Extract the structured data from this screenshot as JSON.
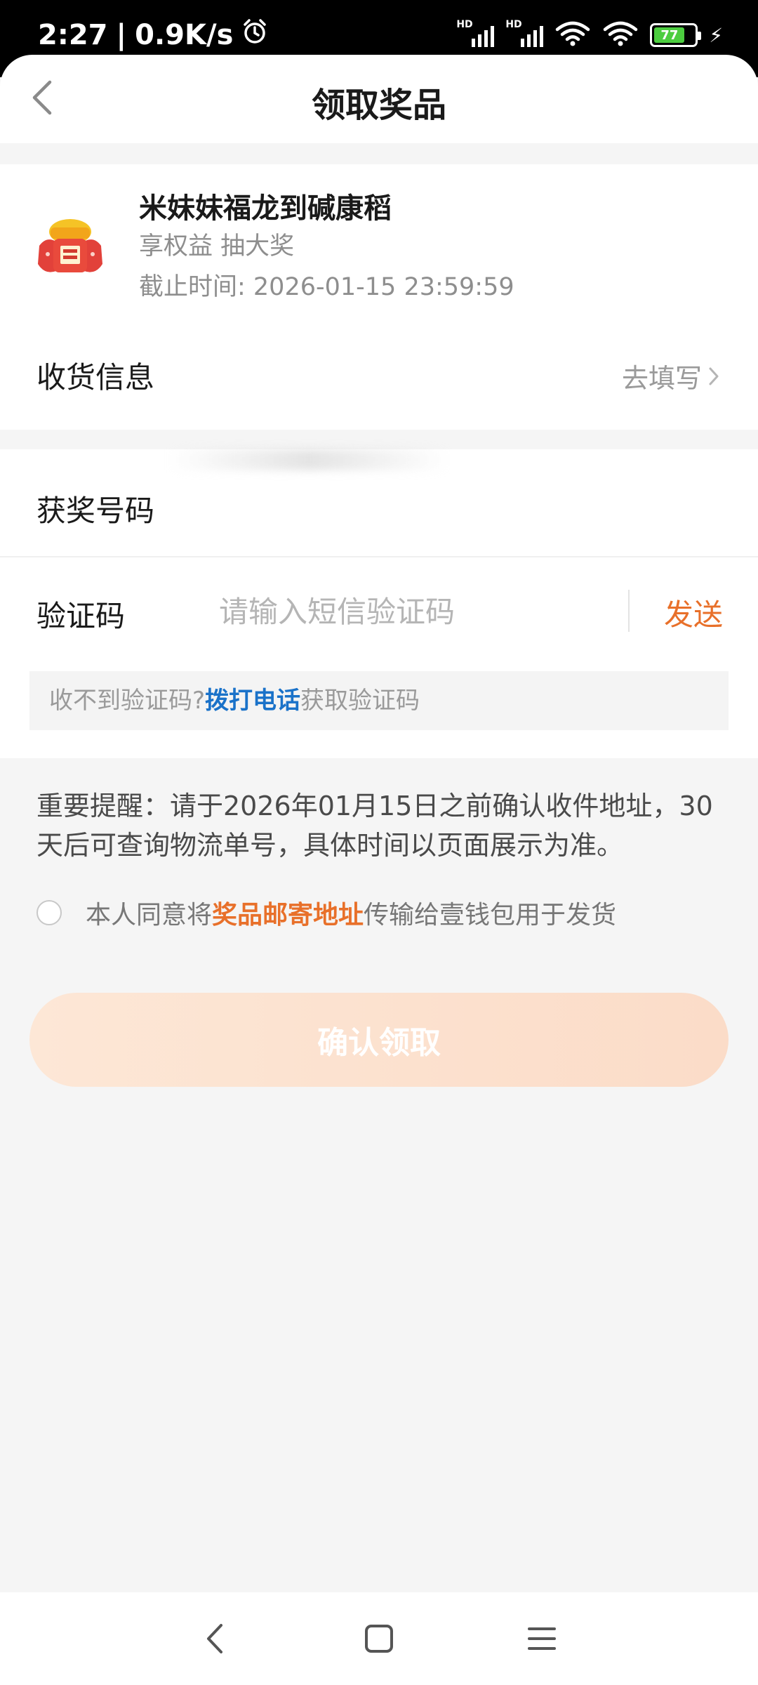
{
  "status_bar": {
    "time": "2:27",
    "speed": "0.9K/s",
    "battery_level": "77",
    "icons": [
      "alarm-icon",
      "signal-icon",
      "wifi-icon",
      "battery-icon",
      "charging-icon"
    ]
  },
  "header": {
    "title": "领取奖品"
  },
  "prize": {
    "name": "米妹妹福龙到碱康稻",
    "subtitle": "享权益 抽大奖",
    "deadline": "截止时间: 2026-01-15 23:59:59"
  },
  "shipping": {
    "label": "收货信息",
    "action": "去填写"
  },
  "form": {
    "winning_number_label": "获奖号码",
    "code_label": "验证码",
    "code_placeholder": "请输入短信验证码",
    "send_label": "发送",
    "tip_prefix": "收不到验证码?",
    "tip_link": "拨打电话",
    "tip_suffix": "获取验证码"
  },
  "notice": {
    "text": "重要提醒：请于2026年01月15日之前确认收件地址，30天后可查询物流单号，具体时间以页面展示为准。"
  },
  "agreement": {
    "prefix": "本人同意将",
    "link": "奖品邮寄地址",
    "suffix": "传输给壹钱包用于发货",
    "checked": false
  },
  "confirm": {
    "label": "确认领取",
    "enabled": false
  },
  "colors": {
    "accent": "#e8702a",
    "link": "#1a72c9",
    "confirm_disabled": "#fde7d6"
  }
}
